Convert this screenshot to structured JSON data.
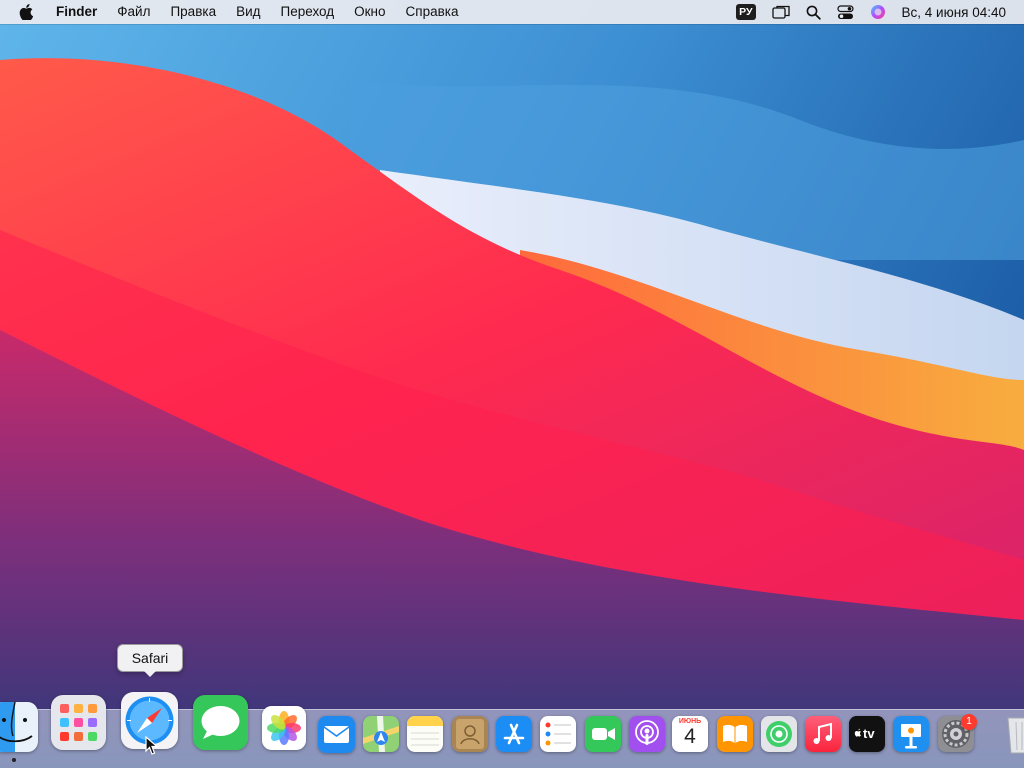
{
  "menubar": {
    "apple_icon": "apple-logo-icon",
    "items": [
      "Finder",
      "Файл",
      "Правка",
      "Вид",
      "Переход",
      "Окно",
      "Справка"
    ],
    "status": {
      "input_language": "РУ",
      "icons": [
        "screen-mirroring-icon",
        "spotlight-search-icon",
        "control-center-icon",
        "siri-icon"
      ],
      "clock": "Вс, 4 июня  04:40"
    }
  },
  "dock": {
    "tooltip": "Safari",
    "apps": [
      {
        "name": "Finder",
        "icon": "finder-icon",
        "running": true
      },
      {
        "name": "Launchpad",
        "icon": "launchpad-icon"
      },
      {
        "name": "Safari",
        "icon": "safari-icon",
        "hovered": true
      },
      {
        "name": "Messages",
        "icon": "messages-icon"
      },
      {
        "name": "Photos",
        "icon": "photos-icon"
      },
      {
        "name": "Mail",
        "icon": "mail-icon"
      },
      {
        "name": "Maps",
        "icon": "maps-icon"
      },
      {
        "name": "Notes",
        "icon": "notes-icon"
      },
      {
        "name": "Contacts",
        "icon": "contacts-icon"
      },
      {
        "name": "App Store",
        "icon": "app-store-icon"
      },
      {
        "name": "Reminders",
        "icon": "reminders-icon"
      },
      {
        "name": "FaceTime",
        "icon": "facetime-icon"
      },
      {
        "name": "Podcasts",
        "icon": "podcasts-icon"
      },
      {
        "name": "Calendar",
        "icon": "calendar-icon"
      },
      {
        "name": "Books",
        "icon": "books-icon"
      },
      {
        "name": "Find My",
        "icon": "find-my-icon"
      },
      {
        "name": "Music",
        "icon": "music-icon"
      },
      {
        "name": "TV",
        "icon": "tv-icon"
      },
      {
        "name": "Keynote",
        "icon": "keynote-icon"
      },
      {
        "name": "System Preferences",
        "icon": "system-preferences-icon",
        "badge": "1"
      },
      {
        "name": "Trash",
        "icon": "trash-icon"
      }
    ],
    "calendar": {
      "month": "ИЮНЬ",
      "day": "4"
    },
    "tv_label": "tv"
  },
  "colors": {
    "wallpaper_blue": "#2f7bc4",
    "wallpaper_red": "#ff2d55",
    "wallpaper_orange": "#f7a83a",
    "wallpaper_purple": "#3a3a8c",
    "badge_red": "#ff3b30"
  }
}
